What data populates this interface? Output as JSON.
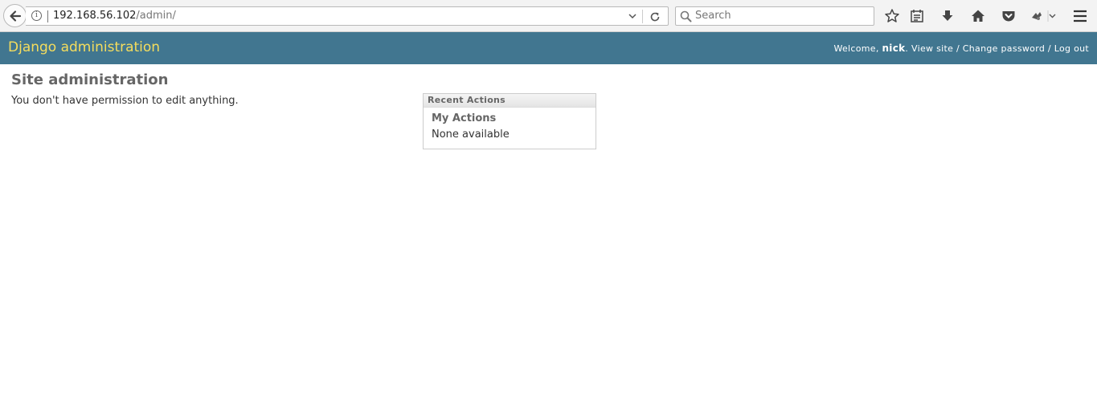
{
  "browser": {
    "url_host": "192.168.56.102",
    "url_path": "/admin/",
    "search_placeholder": "Search"
  },
  "header": {
    "branding": "Django administration",
    "welcome": "Welcome, ",
    "username": "nick",
    "after_username": ". ",
    "view_site": "View site",
    "sep1": " / ",
    "change_password": "Change password",
    "sep2": " / ",
    "logout": "Log out"
  },
  "content": {
    "title": "Site administration",
    "permission_message": "You don't have permission to edit anything."
  },
  "recent_actions": {
    "caption": "Recent Actions",
    "my_actions": "My Actions",
    "none": "None available"
  }
}
